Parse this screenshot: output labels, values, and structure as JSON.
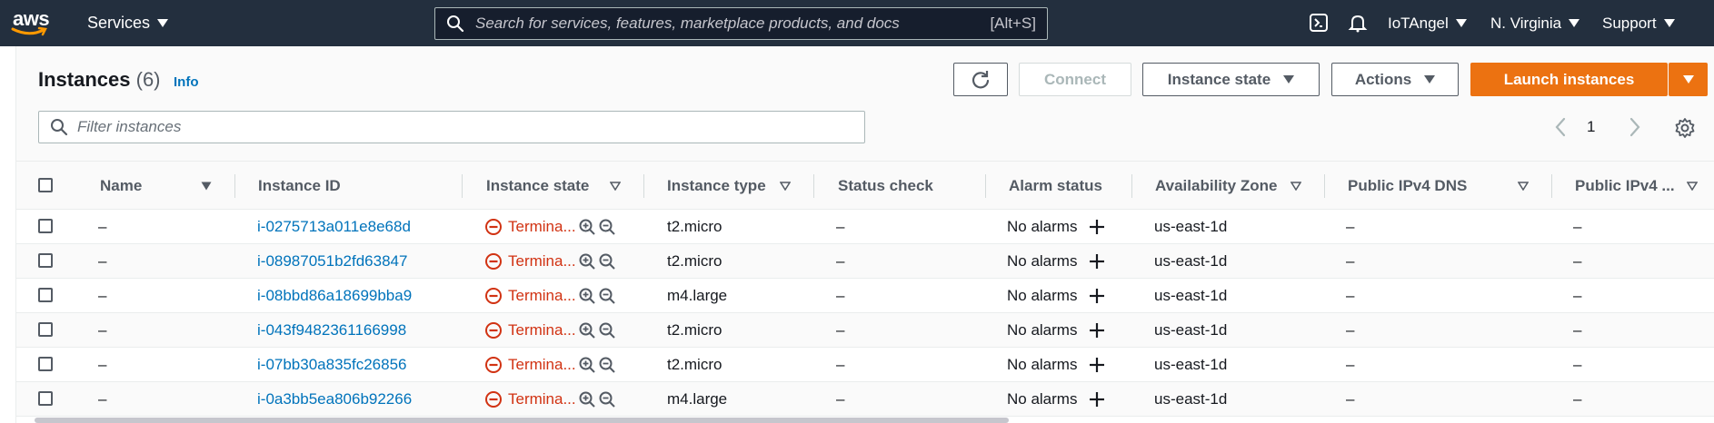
{
  "topnav": {
    "logo_text": "aws",
    "services_label": "Services",
    "search_placeholder": "Search for services, features, marketplace products, and docs",
    "search_shortcut": "[Alt+S]",
    "account_label": "IoTAngel",
    "region_label": "N. Virginia",
    "support_label": "Support"
  },
  "header": {
    "title": "Instances",
    "count": "(6)",
    "info_label": "Info",
    "connect_label": "Connect",
    "instance_state_label": "Instance state",
    "actions_label": "Actions",
    "launch_label": "Launch instances",
    "filter_placeholder": "Filter instances",
    "page_number": "1"
  },
  "table": {
    "columns": {
      "name": "Name",
      "instance_id": "Instance ID",
      "instance_state": "Instance state",
      "instance_type": "Instance type",
      "status_check": "Status check",
      "alarm_status": "Alarm status",
      "availability_zone": "Availability Zone",
      "public_dns": "Public IPv4 DNS",
      "public_ip": "Public IPv4 ..."
    },
    "rows": [
      {
        "name": "–",
        "id": "i-0275713a011e8e68d",
        "state": "Termina...",
        "type": "t2.micro",
        "status": "–",
        "alarm": "No alarms",
        "az": "us-east-1d",
        "dns": "–",
        "ip": "–"
      },
      {
        "name": "–",
        "id": "i-08987051b2fd63847",
        "state": "Termina...",
        "type": "t2.micro",
        "status": "–",
        "alarm": "No alarms",
        "az": "us-east-1d",
        "dns": "–",
        "ip": "–"
      },
      {
        "name": "–",
        "id": "i-08bbd86a18699bba9",
        "state": "Termina...",
        "type": "m4.large",
        "status": "–",
        "alarm": "No alarms",
        "az": "us-east-1d",
        "dns": "–",
        "ip": "–"
      },
      {
        "name": "–",
        "id": "i-043f9482361166998",
        "state": "Termina...",
        "type": "t2.micro",
        "status": "–",
        "alarm": "No alarms",
        "az": "us-east-1d",
        "dns": "–",
        "ip": "–"
      },
      {
        "name": "–",
        "id": "i-07bb30a835fc26856",
        "state": "Termina...",
        "type": "t2.micro",
        "status": "–",
        "alarm": "No alarms",
        "az": "us-east-1d",
        "dns": "–",
        "ip": "–"
      },
      {
        "name": "–",
        "id": "i-0a3bb5ea806b92266",
        "state": "Termina...",
        "type": "m4.large",
        "status": "–",
        "alarm": "No alarms",
        "az": "us-east-1d",
        "dns": "–",
        "ip": "–"
      }
    ]
  },
  "colors": {
    "nav_bg": "#232f3e",
    "accent_orange": "#ec7211",
    "link_blue": "#0073bb",
    "terminated_red": "#d13212"
  },
  "icons": [
    "search-icon",
    "cloudshell-icon",
    "notification-bell-icon",
    "refresh-icon",
    "settings-gear-icon",
    "terminated-icon",
    "zoom-in-icon",
    "zoom-out-icon",
    "add-alarm-icon",
    "sort-icon"
  ]
}
